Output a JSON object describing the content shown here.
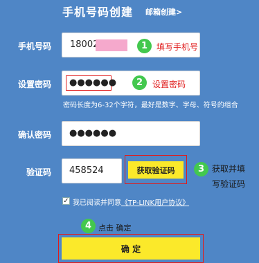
{
  "header": {
    "title": "手机号码创建",
    "email_link": "邮箱创建>"
  },
  "phone": {
    "label": "手机号码",
    "value": "18002"
  },
  "password": {
    "label": "设置密码",
    "value": "●●●●●●",
    "help": "密码长度为6-32个字符，最好是数字、字母、符号的组合"
  },
  "confirm": {
    "label": "确认密码",
    "value": "●●●●●●"
  },
  "captcha": {
    "label": "验证码",
    "value": "458524",
    "button": "获取验证码"
  },
  "agreement": {
    "text": "我已阅读并同意",
    "link": "《TP-LINK用户协议》",
    "checked": true
  },
  "submit": {
    "label": "确 定"
  },
  "annotations": {
    "n1": "1",
    "t1": "填写手机号",
    "n2": "2",
    "t2": "设置密码",
    "n3": "3",
    "t3a": "获取并填",
    "t3b": "写验证码",
    "n4": "4",
    "t4": "点击 确定"
  },
  "colors": {
    "background": "#4f86c6",
    "highlight": "#fbe92a",
    "annotation_green": "#43c84e",
    "annotation_red": "#e01b1b",
    "redacted": "#f5a9cc"
  }
}
